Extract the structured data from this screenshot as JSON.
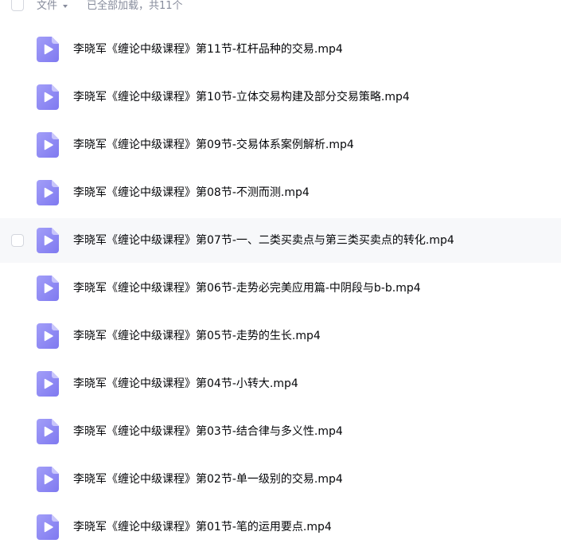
{
  "header": {
    "column_label": "文件",
    "loaded_text": "已全部加载，共11个"
  },
  "icons": {
    "file": "video-file-icon",
    "sort": "caret-down-icon"
  },
  "colors": {
    "icon_purple": "#8f8af5",
    "hover_bg": "#f7f8fa"
  },
  "files": [
    {
      "name": "李晓军《缠论中级课程》第11节-杠杆品种的交易.mp4"
    },
    {
      "name": "李晓军《缠论中级课程》第10节-立体交易构建及部分交易策略.mp4"
    },
    {
      "name": "李晓军《缠论中级课程》第09节-交易体系案例解析.mp4"
    },
    {
      "name": "李晓军《缠论中级课程》第08节-不测而测.mp4"
    },
    {
      "name": "李晓军《缠论中级课程》第07节-一、二类买卖点与第三类买卖点的转化.mp4",
      "hover": true
    },
    {
      "name": "李晓军《缠论中级课程》第06节-走势必完美应用篇-中阴段与b-b.mp4"
    },
    {
      "name": "李晓军《缠论中级课程》第05节-走势的生长.mp4"
    },
    {
      "name": "李晓军《缠论中级课程》第04节-小转大.mp4"
    },
    {
      "name": "李晓军《缠论中级课程》第03节-结合律与多义性.mp4"
    },
    {
      "name": "李晓军《缠论中级课程》第02节-单一级别的交易.mp4"
    },
    {
      "name": "李晓军《缠论中级课程》第01节-笔的运用要点.mp4"
    }
  ]
}
